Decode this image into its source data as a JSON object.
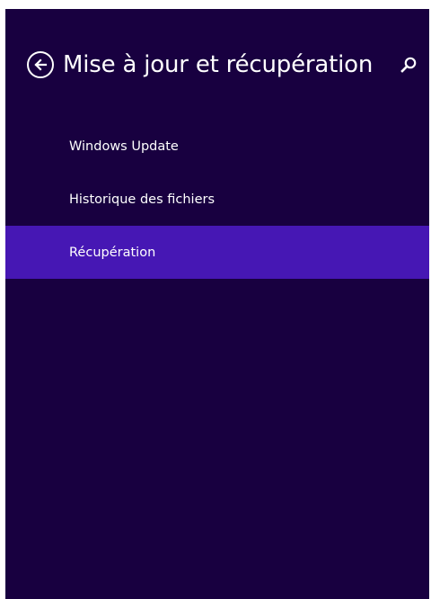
{
  "header": {
    "title": "Mise à jour et récupération",
    "back_icon": "back-arrow-circle-icon",
    "search_icon": "search-icon"
  },
  "nav": {
    "items": [
      {
        "label": "Windows Update",
        "selected": false
      },
      {
        "label": "Historique des fichiers",
        "selected": false
      },
      {
        "label": "Récupération",
        "selected": true
      }
    ]
  },
  "colors": {
    "background": "#180040",
    "selected": "#4617b4",
    "text": "#ffffff"
  }
}
